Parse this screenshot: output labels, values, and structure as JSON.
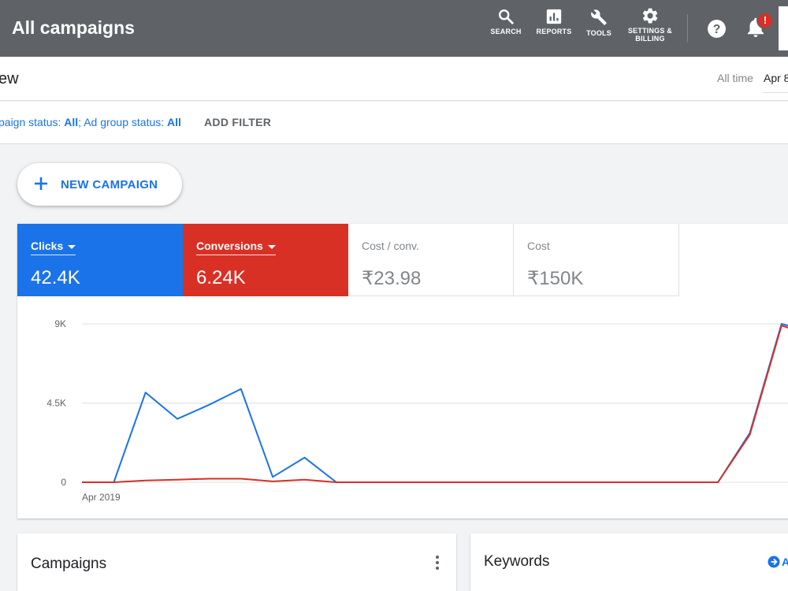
{
  "header": {
    "title": "All campaigns",
    "nav": [
      {
        "label": "SEARCH",
        "icon": "search-icon"
      },
      {
        "label": "REPORTS",
        "icon": "reports-icon"
      },
      {
        "label": "TOOLS",
        "icon": "wrench-icon"
      },
      {
        "label_line1": "SETTINGS &",
        "label_line2": "BILLING",
        "icon": "gear-icon"
      }
    ],
    "help_icon": "help-icon",
    "notifications_icon": "bell-icon",
    "notification_badge": "!"
  },
  "overview": {
    "title": "ew",
    "date_preset": "All time",
    "date_range": "Apr 8"
  },
  "filters": {
    "campaign_status_label": "paign status: ",
    "campaign_status_value": "All",
    "separator": "; ",
    "adgroup_status_label": "Ad group status: ",
    "adgroup_status_value": "All",
    "add_filter": "ADD FILTER"
  },
  "new_campaign": {
    "label": "NEW CAMPAIGN"
  },
  "metrics": [
    {
      "label": "Clicks",
      "value": "42.4K",
      "color": "#1a73e8"
    },
    {
      "label": "Conversions",
      "value": "6.24K",
      "color": "#d93025"
    },
    {
      "label": "Cost / conv.",
      "value": "₹23.98"
    },
    {
      "label": "Cost",
      "value": "₹150K"
    }
  ],
  "chart_data": {
    "type": "line",
    "x_start_label": "Apr 2019",
    "y_ticks": [
      "9K",
      "4.5K",
      "0"
    ],
    "ylim": [
      0,
      9000
    ],
    "grid": true,
    "series": [
      {
        "name": "Clicks",
        "color": "#1a73e8",
        "values": [
          0,
          0,
          5100,
          3600,
          4400,
          5300,
          300,
          1400,
          0,
          0,
          0,
          0,
          0,
          0,
          0,
          0,
          0,
          0,
          0,
          0,
          0,
          2800,
          9000,
          8500
        ]
      },
      {
        "name": "Conversions",
        "color": "#d93025",
        "values": [
          0,
          0,
          100,
          150,
          200,
          200,
          50,
          150,
          0,
          0,
          0,
          0,
          0,
          0,
          0,
          0,
          0,
          0,
          0,
          0,
          0,
          2700,
          8900,
          8300
        ]
      }
    ]
  },
  "bottom_cards": {
    "campaigns_title": "Campaigns",
    "keywords_title": "Keywords",
    "keywords_action": "A"
  }
}
